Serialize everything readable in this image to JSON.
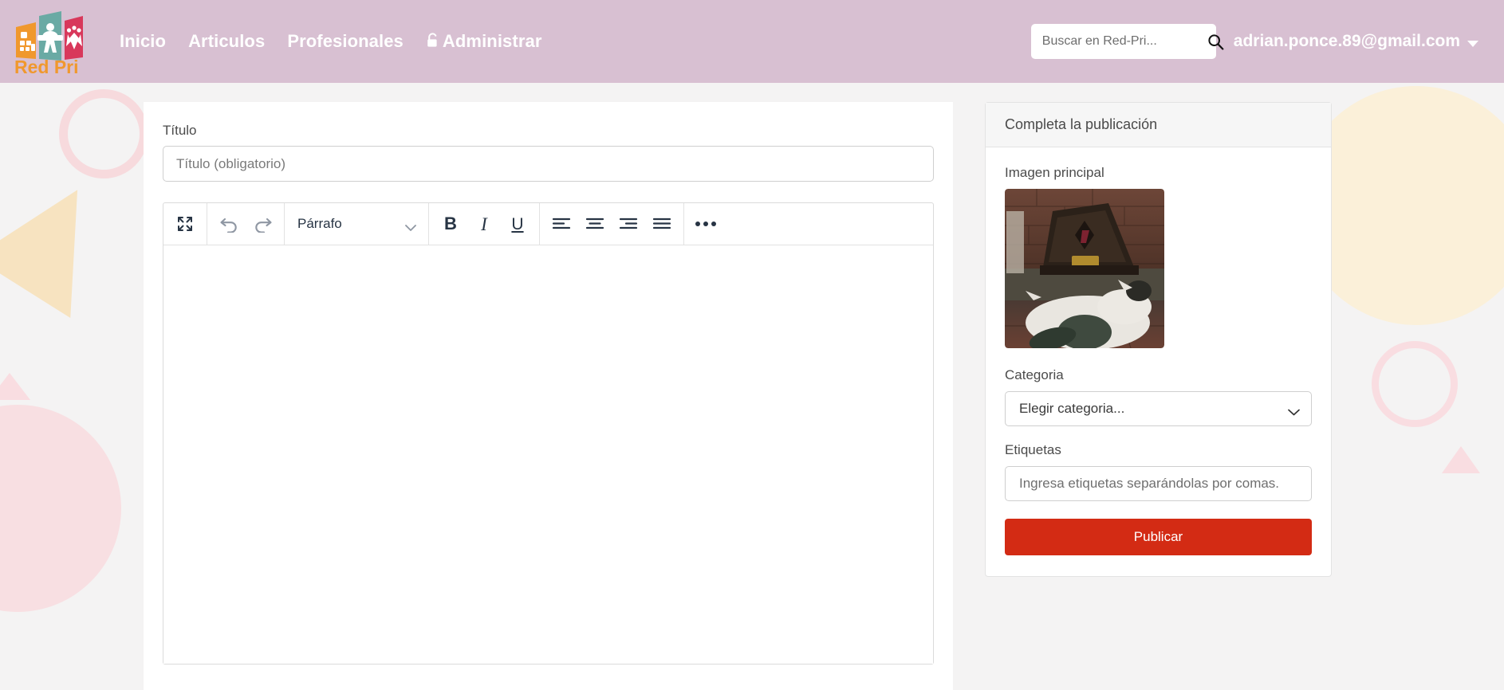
{
  "header": {
    "brand": {
      "logo_name": "red-pri-logo",
      "logo_text": "Red Pri",
      "colors": {
        "orange": "#f0982d",
        "teal": "#6aaaa4",
        "red": "#d8385b"
      }
    },
    "nav": [
      {
        "label": "Inicio",
        "icon": null
      },
      {
        "label": "Articulos",
        "icon": null
      },
      {
        "label": "Profesionales",
        "icon": null
      },
      {
        "label": "Administrar",
        "icon": "lock-icon"
      }
    ],
    "search": {
      "placeholder": "Buscar en Red-Pri...",
      "value": "",
      "icon": "search-icon"
    },
    "user": {
      "email": "adrian.ponce.89@gmail.com",
      "caret": "chevron-down-icon"
    },
    "background_color": "#d8c0d2"
  },
  "editor": {
    "title_label": "Título",
    "title_placeholder": "Título (obligatorio)",
    "title_value": "",
    "toolbar": {
      "fullscreen_label": "Pantalla completa",
      "undo_label": "Deshacer",
      "redo_label": "Rehacer",
      "block_format": "Párrafo",
      "bold_label": "B",
      "italic_label": "I",
      "underline_label": "U",
      "align_left_label": "Alinear a la izquierda",
      "align_center_label": "Centrar",
      "align_right_label": "Alinear a la derecha",
      "justify_label": "Justificar",
      "more_label": "Más opciones"
    },
    "content": ""
  },
  "sidebar": {
    "card_title": "Completa la publicación",
    "image_label": "Imagen principal",
    "image_alt": "Gato blanco y negro recostado en el piso junto a un baúl oscuro",
    "category_label": "Categoria",
    "category_value": "Elegir categoria...",
    "tags_label": "Etiquetas",
    "tags_placeholder": "Ingresa etiquetas separándolas por comas.",
    "tags_value": "",
    "publish_label": "Publicar",
    "publish_color": "#d32b14"
  }
}
